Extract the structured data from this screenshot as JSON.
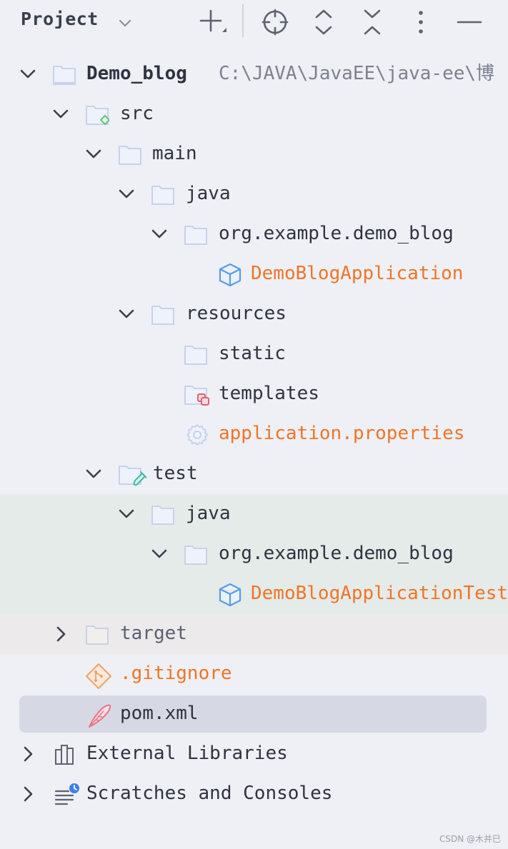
{
  "toolbar": {
    "title": "Project"
  },
  "tree": {
    "root": {
      "label": "Demo_blog",
      "path": "C:\\JAVA\\JavaEE\\java-ee\\博"
    },
    "src": "src",
    "main": "main",
    "main_java": "java",
    "main_pkg": "org.example.demo_blog",
    "main_class": "DemoBlogApplication",
    "resources": "resources",
    "static": "static",
    "templates": "templates",
    "properties": "application.properties",
    "test": "test",
    "test_java": "java",
    "test_pkg": "org.example.demo_blog",
    "test_class": "DemoBlogApplicationTests",
    "target": "target",
    "gitignore": ".gitignore",
    "pom": "pom.xml",
    "external_libraries": "External Libraries",
    "scratches": "Scratches and Consoles"
  },
  "watermark": "CSDN @木井巳",
  "colors": {
    "background": "#eef0f6",
    "orange_text": "#f07427",
    "selection": "#d6d9e3",
    "test_highlight": "#e5ebe8",
    "excluded_highlight": "#eceaea",
    "folder_outline": "#c7d2ea",
    "class_icon": "#5a9be6"
  }
}
